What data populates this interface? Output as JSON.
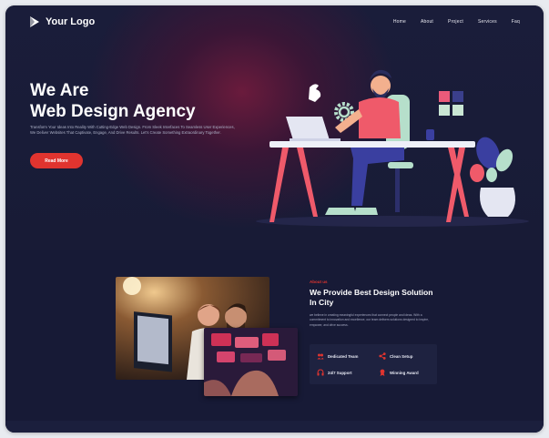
{
  "nav": {
    "logo_text": "Your Logo",
    "items": [
      "Home",
      "About",
      "Project",
      "Services",
      "Faq"
    ]
  },
  "hero": {
    "headline_line1": "We Are",
    "headline_line2": "Web Design Agency",
    "subtext": "Transform Your Ideas Into Reality With Cutting-Edge Web Design. From Sleek Interfaces To Seamless User Experiences, We Deliver Websites That Captivate, Engage, And Drive Results. Let's Create Something Extraordinary Together.",
    "cta_label": "Read More"
  },
  "about": {
    "tag": "About us",
    "title": "We Provide Best Design Solution In City",
    "text": "we believe in creating meaningful experiences that connect people and ideas. With a commitment to innovation and excellence, our team delivers solutions designed to inspire, empower, and drive success.",
    "features": [
      {
        "label": "Dedicated Team",
        "icon": "team-icon"
      },
      {
        "label": "Clean Setup",
        "icon": "share-icon"
      },
      {
        "label": "24/7 Support",
        "icon": "support-icon"
      },
      {
        "label": "Winning Award",
        "icon": "award-icon"
      }
    ]
  },
  "colors": {
    "accent": "#e0342f",
    "background": "#161a33",
    "hero_glow": "#6a1b3c"
  }
}
